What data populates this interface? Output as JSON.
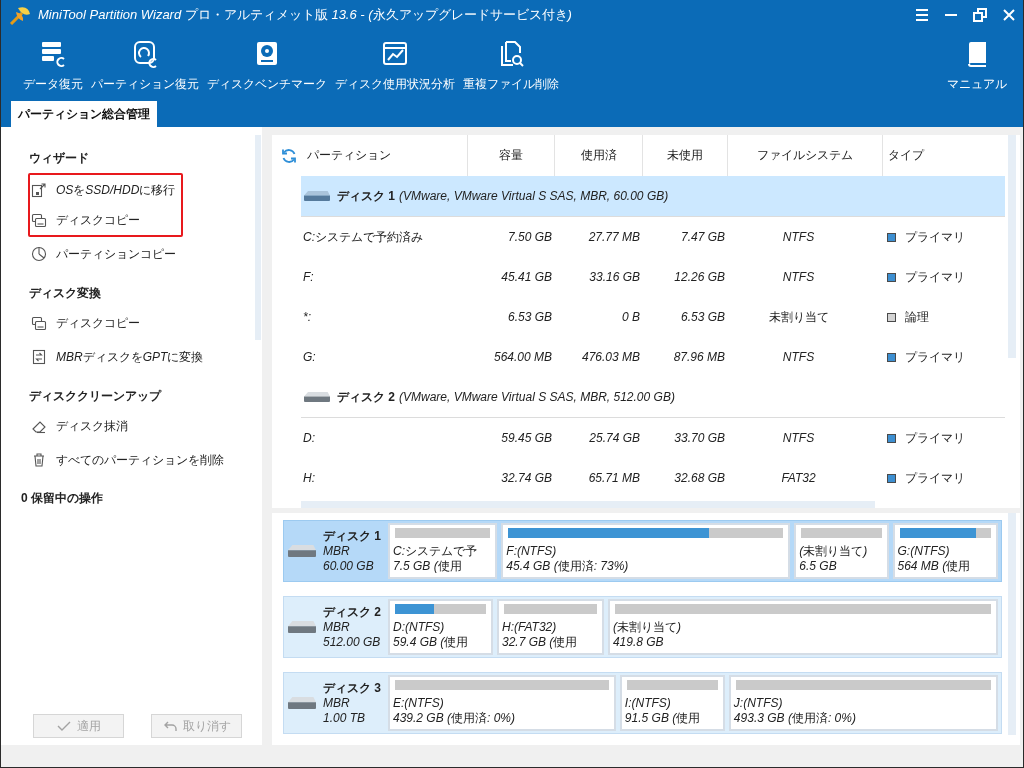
{
  "window": {
    "title": "MiniTool Partition Wizard プロ・アルティメット版 13.6 - (永久アップグレードサービス付き)"
  },
  "toolbar": {
    "items": [
      {
        "label": "データ復元"
      },
      {
        "label": "パーティション復元"
      },
      {
        "label": "ディスクベンチマーク"
      },
      {
        "label": "ディスク使用状況分析"
      },
      {
        "label": "重複ファイル削除"
      }
    ],
    "manual": {
      "label": "マニュアル"
    }
  },
  "tabs": [
    {
      "label": "パーティション総合管理",
      "selected": true
    }
  ],
  "sidebar": {
    "sections": [
      {
        "heading": "ウィザード",
        "items": [
          {
            "label": "OSをSSD/HDDに移行",
            "highlighted": true
          },
          {
            "label": "ディスクコピー",
            "highlighted": true
          },
          {
            "label": "パーティションコピー",
            "highlighted": false
          }
        ]
      },
      {
        "heading": "ディスク変換",
        "items": [
          {
            "label": "ディスクコピー",
            "highlighted": false
          },
          {
            "label": "MBRディスクをGPTに変換",
            "highlighted": false
          }
        ]
      },
      {
        "heading": "ディスククリーンアップ",
        "items": [
          {
            "label": "ディスク抹消",
            "highlighted": false
          },
          {
            "label": "すべてのパーティションを削除",
            "highlighted": false
          }
        ]
      }
    ],
    "pending_operations": "0 保留中の操作",
    "buttons": [
      {
        "label": "適用",
        "disabled": true
      },
      {
        "label": "取り消す",
        "disabled": true
      }
    ]
  },
  "partition_table": {
    "columns": [
      "パーティション",
      "容量",
      "使用済",
      "未使用",
      "ファイルシステム",
      "タイプ"
    ],
    "disks": [
      {
        "name": "ディスク 1",
        "detail": "(VMware, VMware Virtual S SAS, MBR, 60.00 GB)",
        "selected": true,
        "partitions": [
          {
            "partition": "C:システムで予約済み",
            "capacity": "7.50 GB",
            "used": "27.77 MB",
            "unused": "7.47 GB",
            "file_system": "NTFS",
            "type": "プライマリ",
            "color": "#3d8fd1",
            "selected": false
          },
          {
            "partition": "F:",
            "capacity": "45.41 GB",
            "used": "33.16 GB",
            "unused": "12.26 GB",
            "file_system": "NTFS",
            "type": "プライマリ",
            "color": "#3d8fd1",
            "selected": false
          },
          {
            "partition": "*:",
            "capacity": "6.53 GB",
            "used": "0 B",
            "unused": "6.53 GB",
            "file_system": "未割り当て",
            "type": "論理",
            "color": "#d3d3d3",
            "selected": false
          },
          {
            "partition": "G:",
            "capacity": "564.00 MB",
            "used": "476.03 MB",
            "unused": "87.96 MB",
            "file_system": "NTFS",
            "type": "プライマリ",
            "color": "#3d8fd1",
            "selected": false
          }
        ]
      },
      {
        "name": "ディスク 2",
        "detail": "(VMware, VMware Virtual S SAS, MBR, 512.00 GB)",
        "selected": false,
        "partitions": [
          {
            "partition": "D:",
            "capacity": "59.45 GB",
            "used": "25.74 GB",
            "unused": "33.70 GB",
            "file_system": "NTFS",
            "type": "プライマリ",
            "color": "#3d8fd1",
            "selected": false
          },
          {
            "partition": "H:",
            "capacity": "32.74 GB",
            "used": "65.71 MB",
            "unused": "32.68 GB",
            "file_system": "FAT32",
            "type": "プライマリ",
            "color": "#3d8fd1",
            "selected": false
          }
        ]
      }
    ]
  },
  "disk_map": {
    "disks": [
      {
        "name": "ディスク 1",
        "style": "MBR",
        "capacity": "60.00 GB",
        "selected": true,
        "partitions": [
          {
            "label": "C:システムで予",
            "info": "7.5 GB (使用",
            "level": 0,
            "selected": false
          },
          {
            "label": "F:(NTFS)",
            "info": "45.4 GB (使用済: 73%)",
            "level": 0.73,
            "selected": false
          },
          {
            "label": "(未割り当て)",
            "info": "6.5 GB",
            "level": 0,
            "selected": false
          },
          {
            "label": "G:(NTFS)",
            "info": "564 MB (使用",
            "level": 0.84,
            "selected": false
          }
        ]
      },
      {
        "name": "ディスク 2",
        "style": "MBR",
        "capacity": "512.00 GB",
        "selected": false,
        "partitions": [
          {
            "label": "D:(NTFS)",
            "info": "59.4 GB (使用",
            "level": 0.43,
            "selected": false
          },
          {
            "label": "H:(FAT32)",
            "info": "32.7 GB (使用",
            "level": 0,
            "selected": false
          },
          {
            "label": "(未割り当て)",
            "info": "419.8 GB",
            "level": 0,
            "selected": false
          }
        ]
      },
      {
        "name": "ディスク 3",
        "style": "MBR",
        "capacity": "1.00 TB",
        "selected": false,
        "partitions": [
          {
            "label": "E:(NTFS)",
            "info": "439.2 GB (使用済: 0%)",
            "level": 0,
            "selected": false
          },
          {
            "label": "I:(NTFS)",
            "info": "91.5 GB (使用",
            "level": 0,
            "selected": false
          },
          {
            "label": "J:(NTFS)",
            "info": "493.3 GB (使用済: 0%)",
            "level": 0,
            "selected": false
          }
        ]
      }
    ]
  }
}
